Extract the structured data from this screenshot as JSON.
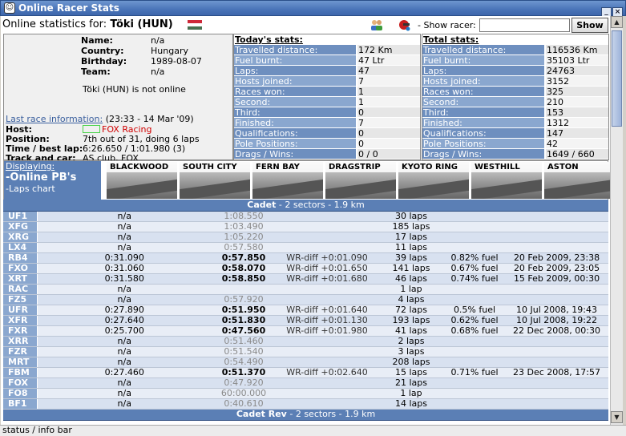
{
  "window": {
    "title": "Online Racer Stats"
  },
  "header": {
    "prefix": "Online statistics for:",
    "racer": "Töki (HUN)",
    "show_label": "- Show racer:",
    "show_input_value": "",
    "show_button": "Show"
  },
  "profile": {
    "name_label": "Name:",
    "name": "n/a",
    "country_label": "Country:",
    "country": "Hungary",
    "birthday_label": "Birthday:",
    "birthday": "1989-08-07",
    "team_label": "Team:",
    "team": "n/a",
    "status": "Töki (HUN) is not online",
    "lastrace_link": "Last race information:",
    "lastrace_when": "(23:33 - 14 Mar '09)",
    "host_label": "Host:",
    "host": "FOX Racing",
    "position_label": "Position:",
    "position": "7th out of 31, doing 6 laps",
    "time_label": "Time / best lap:",
    "time": "6:26.650 / 1:01.980 (3)",
    "track_label": "Track and car:",
    "track": "AS club, FOX"
  },
  "today": {
    "title": "Today's stats:",
    "rows": [
      {
        "k": "Travelled distance:",
        "v": "172 Km"
      },
      {
        "k": "Fuel burnt:",
        "v": "47 Ltr"
      },
      {
        "k": "Laps:",
        "v": "47"
      },
      {
        "k": "Hosts joined:",
        "v": "7"
      },
      {
        "k": "Races won:",
        "v": "1"
      },
      {
        "k": "Second:",
        "v": "1"
      },
      {
        "k": "Third:",
        "v": "0"
      },
      {
        "k": "Finished:",
        "v": "7"
      },
      {
        "k": "Qualifications:",
        "v": "0"
      },
      {
        "k": "Pole Positions:",
        "v": "0"
      },
      {
        "k": "Drags / Wins:",
        "v": "0 / 0"
      }
    ]
  },
  "total": {
    "title": "Total stats:",
    "rows": [
      {
        "k": "Travelled distance:",
        "v": "116536 Km"
      },
      {
        "k": "Fuel burnt:",
        "v": "35103 Ltr"
      },
      {
        "k": "Laps:",
        "v": "24763"
      },
      {
        "k": "Hosts joined:",
        "v": "3152"
      },
      {
        "k": "Races won:",
        "v": "325"
      },
      {
        "k": "Second:",
        "v": "210"
      },
      {
        "k": "Third:",
        "v": "153"
      },
      {
        "k": "Finished:",
        "v": "1312"
      },
      {
        "k": "Qualifications:",
        "v": "147"
      },
      {
        "k": "Pole Positions:",
        "v": "42"
      },
      {
        "k": "Drags / Wins:",
        "v": "1649 / 660"
      }
    ]
  },
  "display": {
    "link": "Displaying:",
    "mode": "-Online PB's",
    "alt": "-Laps chart"
  },
  "tracks": [
    "BLACKWOOD",
    "SOUTH CITY",
    "FERN BAY",
    "DRAGSTRIP",
    "KYOTO RING",
    "WESTHILL",
    "ASTON"
  ],
  "groups": [
    {
      "title": "Cadet",
      "sub": " - 2 sectors - 1.9 km",
      "rows": [
        [
          "UF1",
          "n/a",
          "1:08.550",
          "",
          "30 laps",
          "",
          ""
        ],
        [
          "XFG",
          "n/a",
          "1:03.490",
          "",
          "185 laps",
          "",
          ""
        ],
        [
          "XRG",
          "n/a",
          "1:05.220",
          "",
          "17 laps",
          "",
          ""
        ],
        [
          "LX4",
          "n/a",
          "0:57.580",
          "",
          "11 laps",
          "",
          ""
        ],
        [
          "RB4",
          "0:31.090",
          "0:57.850",
          "WR-diff +0:01.090",
          "39 laps",
          "0.82% fuel",
          "20 Feb 2009, 23:38"
        ],
        [
          "FXO",
          "0:31.060",
          "0:58.070",
          "WR-diff +0:01.650",
          "141 laps",
          "0.67% fuel",
          "20 Feb 2009, 23:05"
        ],
        [
          "XRT",
          "0:31.580",
          "0:58.850",
          "WR-diff +0:01.680",
          "46 laps",
          "0.74% fuel",
          "15 Feb 2009, 00:30"
        ],
        [
          "RAC",
          "n/a",
          "",
          "",
          "1 lap",
          "",
          ""
        ],
        [
          "FZ5",
          "n/a",
          "0:57.920",
          "",
          "4 laps",
          "",
          ""
        ],
        [
          "UFR",
          "0:27.890",
          "0:51.950",
          "WR-diff +0:01.640",
          "72 laps",
          "0.5% fuel",
          "10 Jul 2008, 19:43"
        ],
        [
          "XFR",
          "0:27.640",
          "0:51.830",
          "WR-diff +0:01.130",
          "193 laps",
          "0.62% fuel",
          "10 Jul 2008, 19:22"
        ],
        [
          "FXR",
          "0:25.700",
          "0:47.560",
          "WR-diff +0:01.980",
          "41 laps",
          "0.68% fuel",
          "22 Dec 2008, 00:30"
        ],
        [
          "XRR",
          "n/a",
          "0:51.460",
          "",
          "2 laps",
          "",
          ""
        ],
        [
          "FZR",
          "n/a",
          "0:51.540",
          "",
          "3 laps",
          "",
          ""
        ],
        [
          "MRT",
          "n/a",
          "0:54.490",
          "",
          "208 laps",
          "",
          ""
        ],
        [
          "FBM",
          "0:27.460",
          "0:51.370",
          "WR-diff +0:02.640",
          "15 laps",
          "0.71% fuel",
          "23 Dec 2008, 17:57"
        ],
        [
          "FOX",
          "n/a",
          "0:47.920",
          "",
          "21 laps",
          "",
          ""
        ],
        [
          "FO8",
          "n/a",
          "60:00.000",
          "",
          "1 lap",
          "",
          ""
        ],
        [
          "BF1",
          "n/a",
          "0:40.610",
          "",
          "14 laps",
          "",
          ""
        ]
      ]
    },
    {
      "title": "Cadet Rev",
      "sub": " - 2 sectors - 1.9 km",
      "rows": []
    }
  ],
  "statusbar": {
    "text": "status / info bar"
  }
}
